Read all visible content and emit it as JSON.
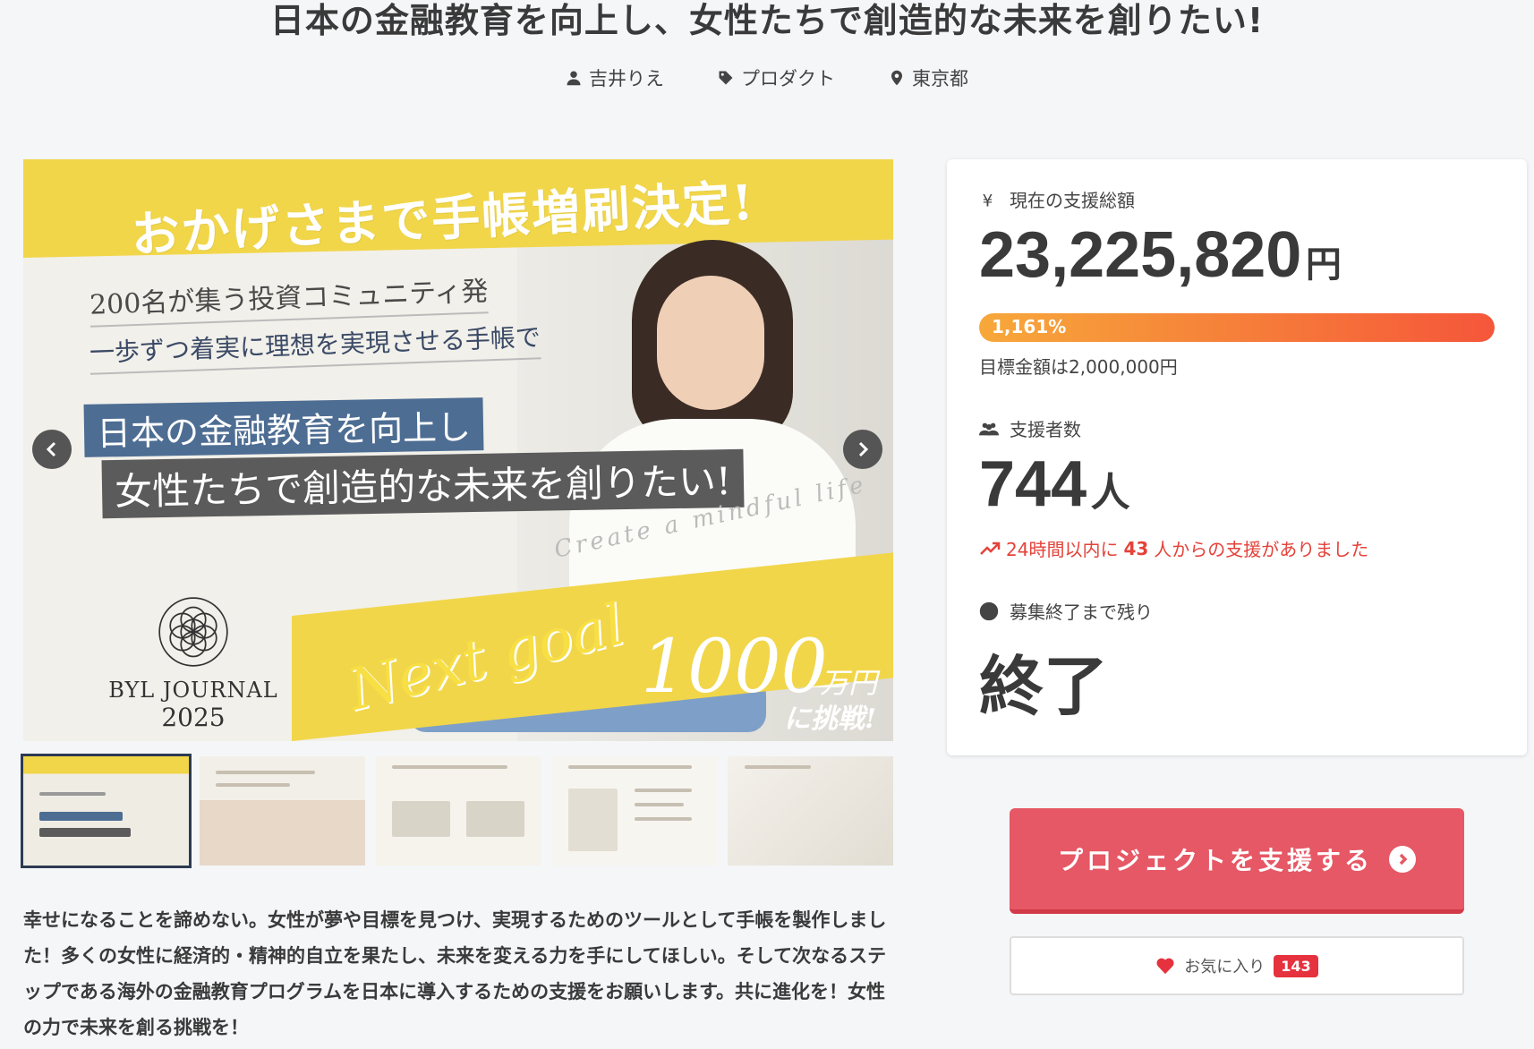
{
  "project": {
    "title": "日本の金融教育を向上し、女性たちで創造的な未来を創りたい!",
    "owner": "吉井りえ",
    "category": "プロダクト",
    "location": "東京都",
    "description": "幸せになることを諦めない。女性が夢や目標を見つけ、実現するためのツールとして手帳を製作しました！多くの女性に経済的・精神的自立を果たし、未来を変える力を手にしてほしい。そして次なるステップである海外の金融教育プログラムを日本に導入するための支援をお願いします。共に進化を！女性の力で未来を創る挑戦を！"
  },
  "hero": {
    "banner": "おかげさまで手帳増刷決定!",
    "sub1": "200名が集う投資コミュニティ発",
    "sub2": "一歩ずつ着実に理想を実現させる手帳で",
    "headline1": "日本の金融教育を向上し",
    "headline2": "女性たちで創造的な未来を創りたい!",
    "script_text": "Create a mindful life",
    "next_goal": "Next goal",
    "goal_amount": "1000",
    "goal_unit": "万円",
    "goal_challenge": "に挑戦!",
    "logo_name": "BYL JOURNAL",
    "logo_year": "2025"
  },
  "stats": {
    "total_label": "現在の支援総額",
    "total_amount": "23,225,820",
    "total_unit": "円",
    "progress_percent": "1,161%",
    "progress_fraction": 1.0,
    "target_text": "目標金額は2,000,000円",
    "supporters_label": "支援者数",
    "supporters_count": "744",
    "supporters_unit": "人",
    "recent_prefix": "24時間以内に",
    "recent_count": "43",
    "recent_suffix": "人からの支援がありました",
    "remaining_label": "募集終了まで残り",
    "remaining_value": "終了"
  },
  "actions": {
    "support_label": "プロジェクトを支援する",
    "favorite_label": "お気に入り",
    "favorite_count": "143"
  },
  "colors": {
    "accent": "#e65865",
    "progress_start": "#f7a83a",
    "progress_end": "#f5563a",
    "trend": "#e4423a"
  }
}
